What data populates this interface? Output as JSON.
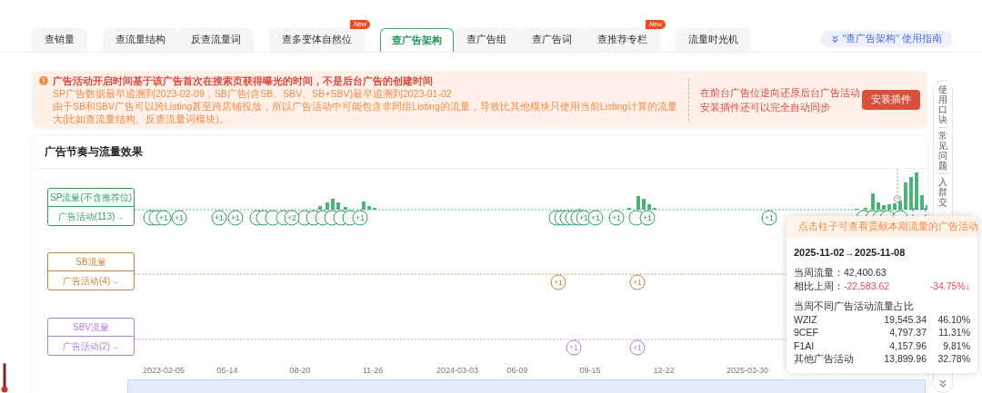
{
  "tab_groups": [
    [
      {
        "label": "查销量",
        "selected": false
      }
    ],
    [
      {
        "label": "查流量结构",
        "selected": false
      },
      {
        "label": "反查流量词",
        "selected": false
      }
    ],
    [
      {
        "label": "查多变体自然位",
        "selected": false,
        "badge": "New"
      }
    ],
    [
      {
        "label": "查广告架构",
        "selected": true
      },
      {
        "label": "查广告组",
        "selected": false
      },
      {
        "label": "查广告词",
        "selected": false
      },
      {
        "label": "查推荐专栏",
        "selected": false,
        "badge": "New"
      }
    ],
    [
      {
        "label": "流量时光机",
        "selected": false
      }
    ]
  ],
  "guide_link": "\"查广告架构\" 使用指南",
  "notice": {
    "title": "广告活动开启时间基于该广告首次在搜索页获得曝光的时间，不是后台广告的创建时间",
    "lines": [
      "SP广告数据最早追溯到2023-02-09，SB广告(含SB、SBV、SB+SBV)最早追溯到2023-01-02",
      "由于SB和SBV广告可以跨Listing甚至跨店铺投放，所以广告活动中可能包含非同组Listing的流量，导致比其他模块只使用当前Listing计算的流量大(比如查流量结构、反查流量词模块)。"
    ],
    "plugin_lines": [
      "在前台广告位逆向还原后台广告活动",
      "安装插件还可以完全自动同步"
    ],
    "install_button": "安装插件"
  },
  "side_panel": [
    "使用口诀",
    "常见问题",
    "入群交"
  ],
  "chart": {
    "title": "广告节奏与流量效果",
    "rows": [
      {
        "kind": "sp",
        "traffic_label": "SP流量(不含推荐位)",
        "activity_label": "广告活动(113)→",
        "markers": [
          "+1",
          "+1",
          "+1",
          "+1",
          "+2",
          "+1",
          "+1",
          "+1",
          "+1",
          "+1",
          "+1"
        ]
      },
      {
        "kind": "sb",
        "traffic_label": "SB流量",
        "activity_label": "广告活动(4)→",
        "markers": [
          "+1",
          "+1"
        ]
      },
      {
        "kind": "sbv",
        "traffic_label": "SBV流量",
        "activity_label": "广告活动(2)→",
        "markers": [
          "+1",
          "+1"
        ]
      }
    ],
    "zoom_range": {
      "level": 1
    },
    "x_ticks": [
      "2023-02-05",
      "05-14",
      "08-20",
      "11-26",
      "2024-03-03",
      "06-09",
      "09-15",
      "12-22",
      "2025-03-30"
    ],
    "tooltip": {
      "hint": "点击柱子可查看贡献本期流量的广告活动",
      "period": "2025-11-02→2025-11-08",
      "week_label": "当周流量：",
      "week_value": "42,400.63",
      "change_label": "相比上周：",
      "change_value": "-22,583.62",
      "change_percent": "-34.75%↓",
      "share_title": "当周不同广告活动流量占比",
      "shares": [
        {
          "name": "WZIZ",
          "value": "19,545.34",
          "percent": "46.10%"
        },
        {
          "name": "9CEF",
          "value": "4,797.37",
          "percent": "11.31%"
        },
        {
          "name": "F1AI",
          "value": "4,157.96",
          "percent": "9.81%"
        },
        {
          "name": "其他广告活动",
          "value": "13,899.96",
          "percent": "32.78%"
        }
      ]
    }
  }
}
